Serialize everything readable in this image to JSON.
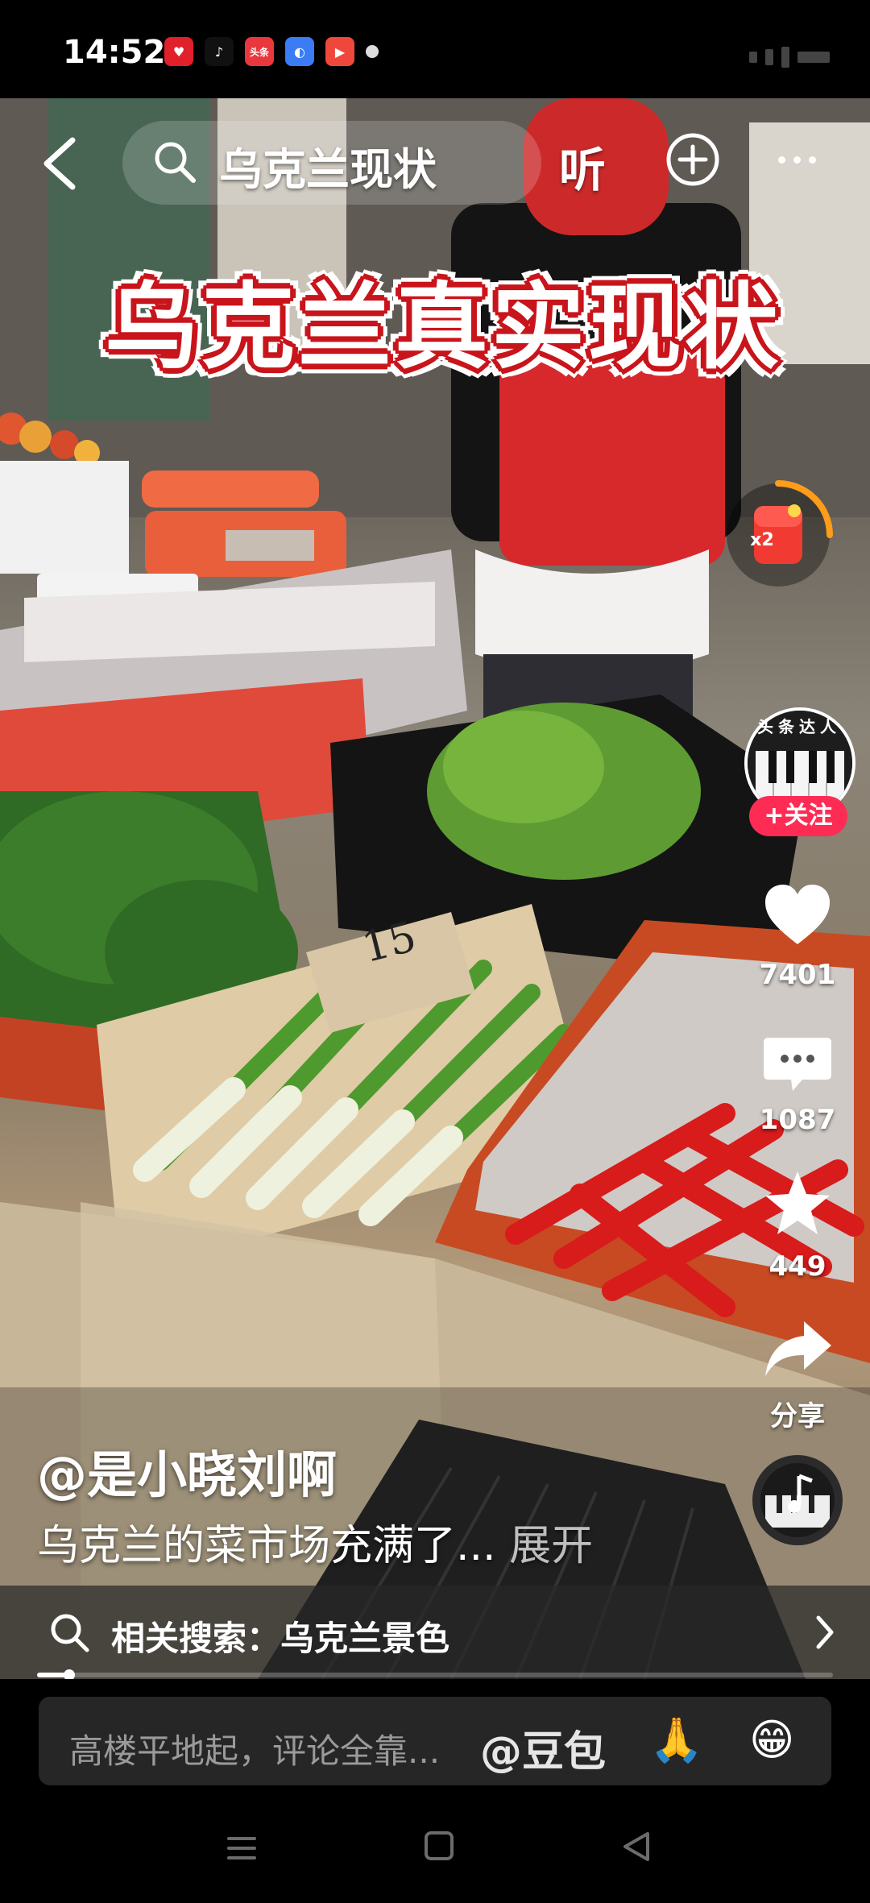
{
  "status_bar": {
    "time": "14:52",
    "app_icons": [
      {
        "name": "heart-app-icon",
        "color": "#e0202a",
        "glyph": "♥"
      },
      {
        "name": "tiktok-app-icon",
        "color": "#111111",
        "glyph": "♪"
      },
      {
        "name": "toutiao-app-icon",
        "color": "#e8383d",
        "glyph": "头条"
      },
      {
        "name": "blue-app-icon",
        "color": "#3b7cf5",
        "glyph": "◐"
      },
      {
        "name": "video-app-icon",
        "color": "#f0473c",
        "glyph": "▶"
      }
    ]
  },
  "top_bar": {
    "search_query": "乌克兰现状",
    "listen_label": "听"
  },
  "video": {
    "headline": "乌克兰真实现状",
    "price_tag": "15"
  },
  "right_rail": {
    "red_packet_badge": "x2",
    "avatar_label": "头条达人",
    "follow_label": "+关注",
    "likes": "7401",
    "comments": "1087",
    "favorites": "449",
    "share_label": "分享"
  },
  "caption": {
    "author": "@是小晓刘啊",
    "description": "乌克兰的菜市场充满了...",
    "expand_label": "展开"
  },
  "related_search": {
    "label": "相关搜索：乌克兰景色",
    "progress": 0.04
  },
  "comment_bar": {
    "placeholder": "高楼平地起，评论全靠...",
    "mention": "@豆包",
    "emoji_1": "🙏",
    "emoji_2": "😁"
  },
  "colors": {
    "accent_red": "#fe2c55",
    "headline_red": "#c8141b",
    "progress_track": "#ffffff"
  }
}
